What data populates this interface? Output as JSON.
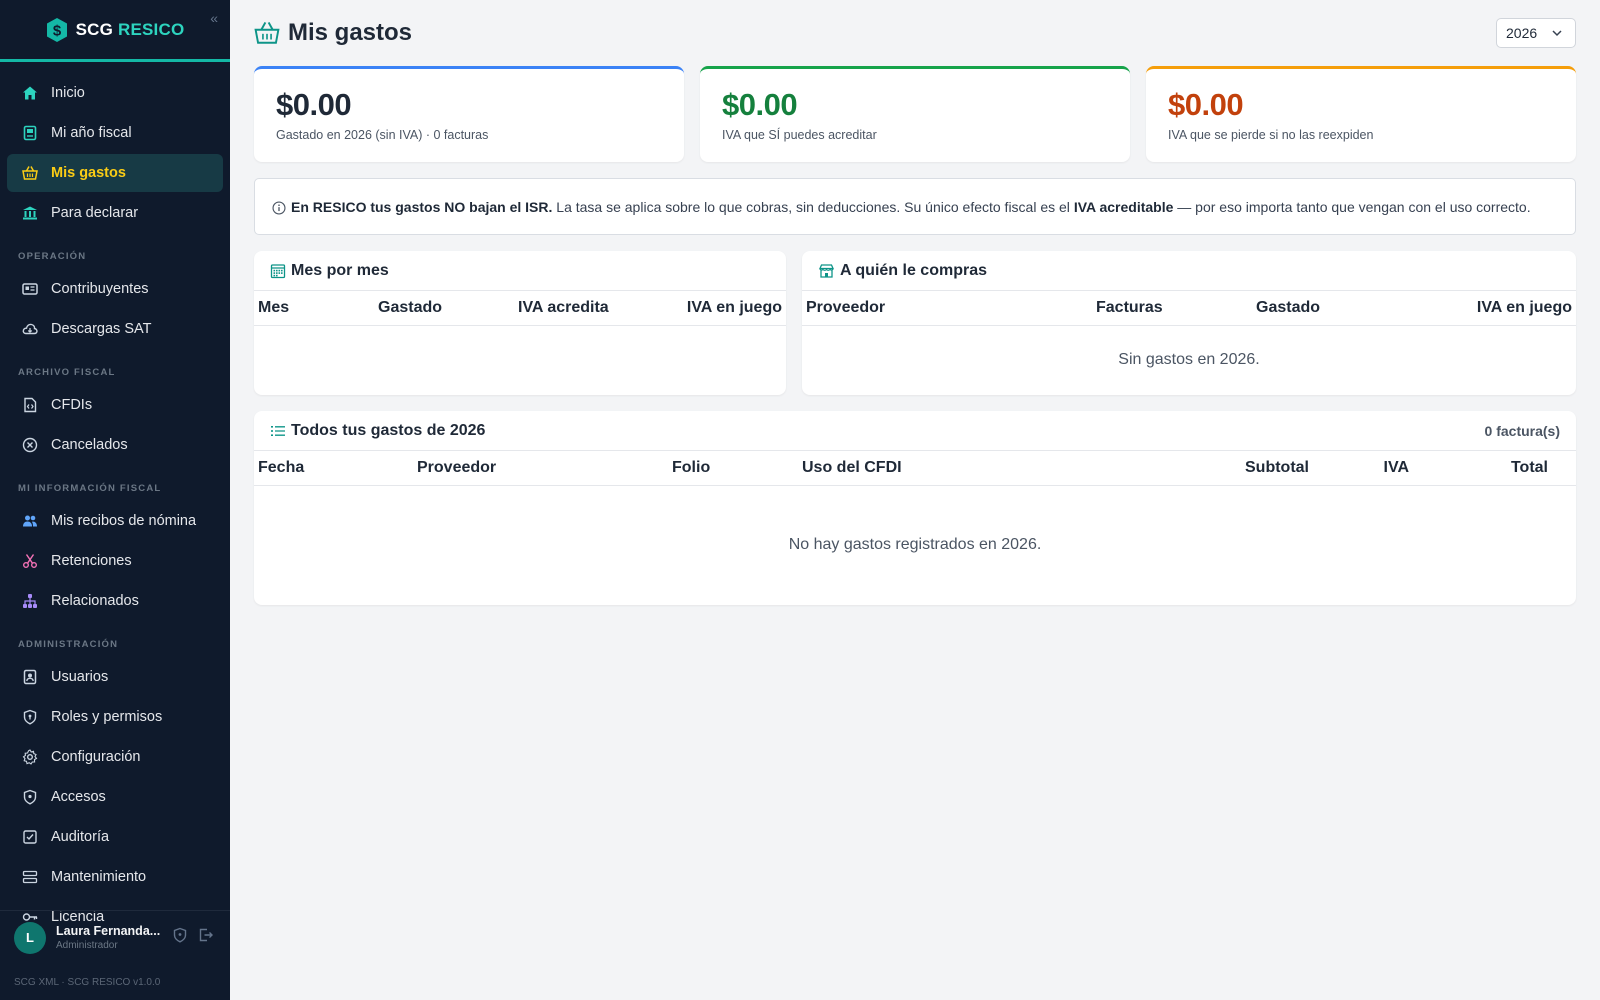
{
  "brand": {
    "prefix": "SCG",
    "name": "RESICO"
  },
  "sidebar": {
    "items_main": [
      {
        "label": "Inicio",
        "icon": "home-icon"
      },
      {
        "label": "Mi año fiscal",
        "icon": "id-badge-icon"
      },
      {
        "label": "Mis gastos",
        "icon": "basket-icon",
        "active": true
      },
      {
        "label": "Para declarar",
        "icon": "bank-icon"
      }
    ],
    "sections": [
      {
        "title": "OPERACIÓN",
        "items": [
          {
            "label": "Contribuyentes",
            "icon": "id-card-icon"
          },
          {
            "label": "Descargas SAT",
            "icon": "cloud-download-icon"
          }
        ]
      },
      {
        "title": "ARCHIVO FISCAL",
        "items": [
          {
            "label": "CFDIs",
            "icon": "file-code-icon"
          },
          {
            "label": "Cancelados",
            "icon": "x-circle-icon"
          }
        ]
      },
      {
        "title": "MI INFORMACIÓN FISCAL",
        "items": [
          {
            "label": "Mis recibos de nómina",
            "icon": "users-icon"
          },
          {
            "label": "Retenciones",
            "icon": "scissors-icon"
          },
          {
            "label": "Relacionados",
            "icon": "hierarchy-icon"
          }
        ]
      },
      {
        "title": "ADMINISTRACIÓN",
        "items": [
          {
            "label": "Usuarios",
            "icon": "id-badge-icon"
          },
          {
            "label": "Roles y permisos",
            "icon": "shield-icon"
          },
          {
            "label": "Configuración",
            "icon": "gear-icon"
          },
          {
            "label": "Accesos",
            "icon": "shield-lock-icon"
          },
          {
            "label": "Auditoría",
            "icon": "checklist-icon"
          },
          {
            "label": "Mantenimiento",
            "icon": "server-icon"
          },
          {
            "label": "Licencia",
            "icon": "key-icon"
          }
        ]
      }
    ]
  },
  "user": {
    "initial": "L",
    "name": "Laura Fernanda...",
    "role": "Administrador"
  },
  "footer": "SCG XML · SCG RESICO v1.0.0",
  "header": {
    "title": "Mis gastos",
    "year": "2026"
  },
  "cards": [
    {
      "value": "$0.00",
      "label": "Gastado en 2026 (sin IVA) · 0 facturas",
      "accent": "#3b82f6",
      "color": "#1f2937"
    },
    {
      "value": "$0.00",
      "label": "IVA que SÍ puedes acreditar",
      "accent": "#16a34a",
      "color": "#15803d"
    },
    {
      "value": "$0.00",
      "label": "IVA que se pierde si no las reexpiden",
      "accent": "#f59e0b",
      "color": "#c2410c"
    }
  ],
  "info": {
    "bold1": "En RESICO tus gastos NO bajan el ISR.",
    "text1": " La tasa se aplica sobre lo que cobras, sin deducciones. Su único efecto fiscal es el ",
    "bold2": "IVA acreditable",
    "text2": " — por eso importa tanto que vengan con el uso correcto."
  },
  "monthly": {
    "title": "Mes por mes",
    "columns": [
      "Mes",
      "Gastado",
      "IVA acredita",
      "IVA en juego"
    ]
  },
  "suppliers": {
    "title": "A quién le compras",
    "columns": [
      "Proveedor",
      "Facturas",
      "Gastado",
      "IVA en juego"
    ],
    "empty": "Sin gastos en 2026."
  },
  "expenses": {
    "title": "Todos tus gastos de 2026",
    "count": "0 factura(s)",
    "columns": [
      "Fecha",
      "Proveedor",
      "Folio",
      "Uso del CFDI",
      "Subtotal",
      "IVA",
      "Total"
    ],
    "empty": "No hay gastos registrados en 2026."
  }
}
